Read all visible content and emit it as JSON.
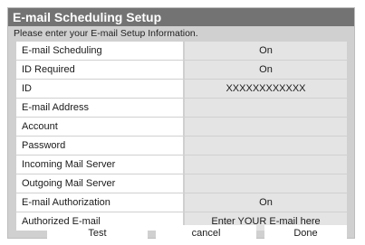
{
  "dialog": {
    "title": "E-mail Scheduling Setup",
    "instructions": "Please enter your E-mail Setup Information."
  },
  "rows": [
    {
      "label": "E-mail Scheduling",
      "value": "On"
    },
    {
      "label": "ID Required",
      "value": "On"
    },
    {
      "label": "ID",
      "value": "XXXXXXXXXXXX"
    },
    {
      "label": "E-mail Address",
      "value": ""
    },
    {
      "label": "Account",
      "value": ""
    },
    {
      "label": "Password",
      "value": ""
    },
    {
      "label": "Incoming Mail Server",
      "value": ""
    },
    {
      "label": "Outgoing Mail Server",
      "value": ""
    },
    {
      "label": "E-mail Authorization",
      "value": "On"
    },
    {
      "label": "Authorized E-mail",
      "value": "Enter YOUR E-mail here"
    }
  ],
  "buttons": {
    "test": "Test",
    "cancel": "cancel",
    "done": "Done"
  }
}
